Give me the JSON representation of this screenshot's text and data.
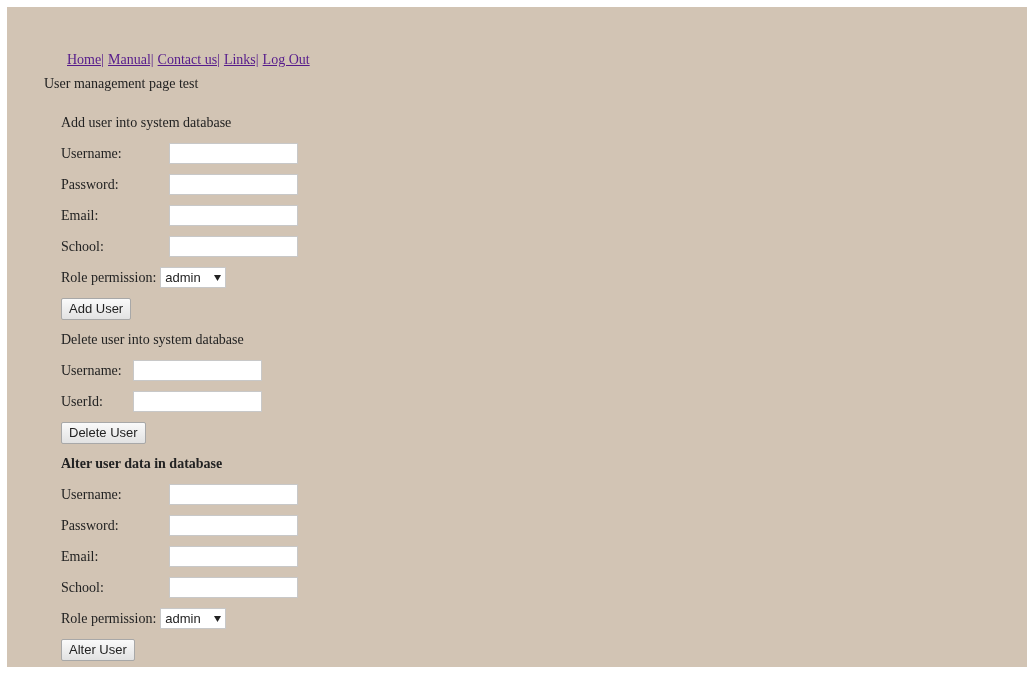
{
  "nav_links": [
    "Home|",
    "Manual|",
    "Contact us|",
    "Links|",
    "Log Out"
  ],
  "title": "User management page test",
  "sections": [
    {
      "heading": "Add user into system database",
      "heading_bold": false,
      "fields": [
        {
          "label": "Username:",
          "kind": "aligned"
        },
        {
          "label": "Password:",
          "kind": "aligned"
        },
        {
          "label": "Email:",
          "kind": "aligned"
        },
        {
          "label": "School:",
          "kind": "aligned"
        }
      ],
      "select": {
        "label": "Role permission:",
        "value": "admin"
      },
      "button": "Add User"
    },
    {
      "heading": "Delete user into system database",
      "heading_bold": false,
      "fields": [
        {
          "label": "Username:",
          "kind": "inline"
        },
        {
          "label": "UserId:",
          "kind": "inline"
        }
      ],
      "button": "Delete User"
    },
    {
      "heading": "Alter user data in database",
      "heading_bold": true,
      "fields": [
        {
          "label": "Username:",
          "kind": "aligned"
        },
        {
          "label": "Password:",
          "kind": "aligned"
        },
        {
          "label": "Email:",
          "kind": "aligned"
        },
        {
          "label": "School:",
          "kind": "aligned"
        }
      ],
      "select": {
        "label": "Role permission:",
        "value": "admin"
      },
      "button": "Alter User"
    }
  ]
}
